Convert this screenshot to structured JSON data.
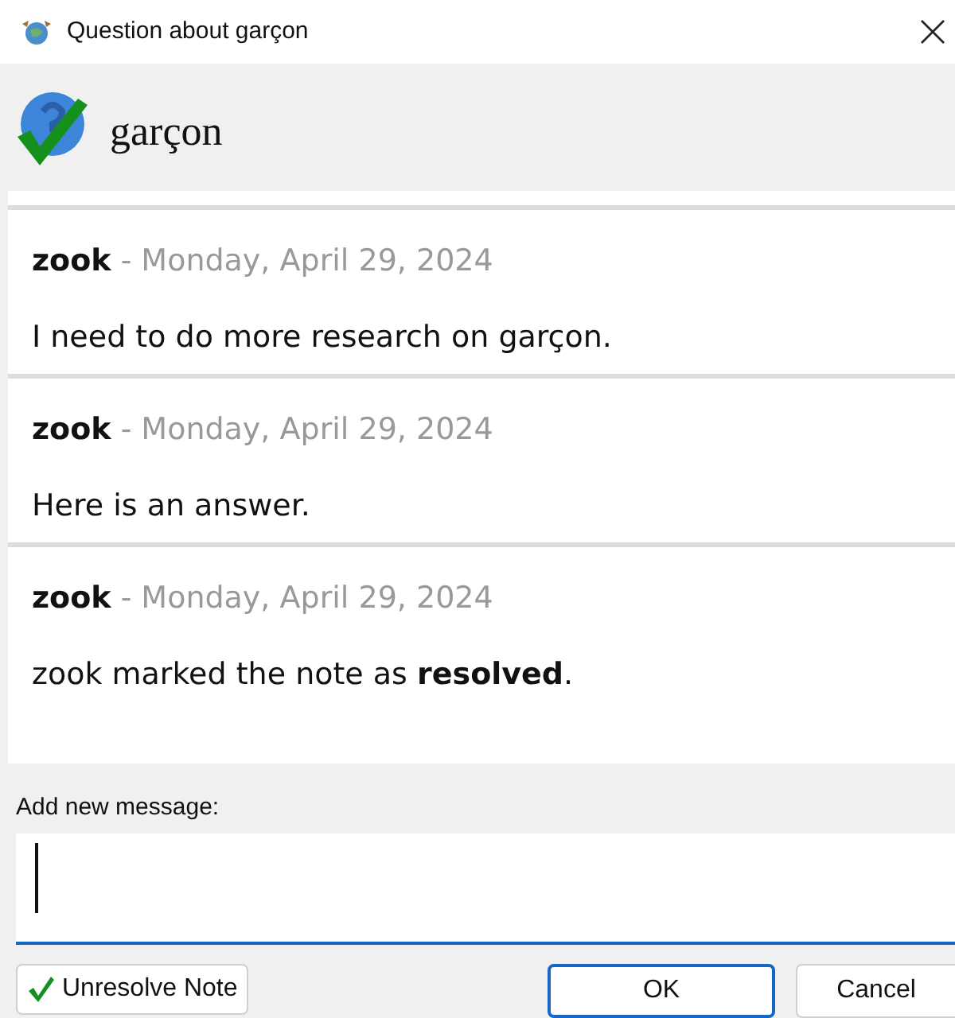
{
  "window": {
    "title": "Question about garçon"
  },
  "header": {
    "term": "garçon"
  },
  "messages": [
    {
      "author": "zook",
      "separator": "-",
      "date": "Monday, April 29, 2024",
      "text": "I need to do more research on garçon."
    },
    {
      "author": "zook",
      "separator": "-",
      "date": "Monday, April 29, 2024",
      "text": "Here is an answer."
    },
    {
      "author": "zook",
      "separator": "-",
      "date": "Monday, April 29, 2024",
      "text": "zook marked the note as **resolved**."
    }
  ],
  "new_message": {
    "label": "Add new message:"
  },
  "buttons": {
    "unresolve": "Unresolve Note",
    "ok": "OK",
    "cancel": "Cancel"
  }
}
